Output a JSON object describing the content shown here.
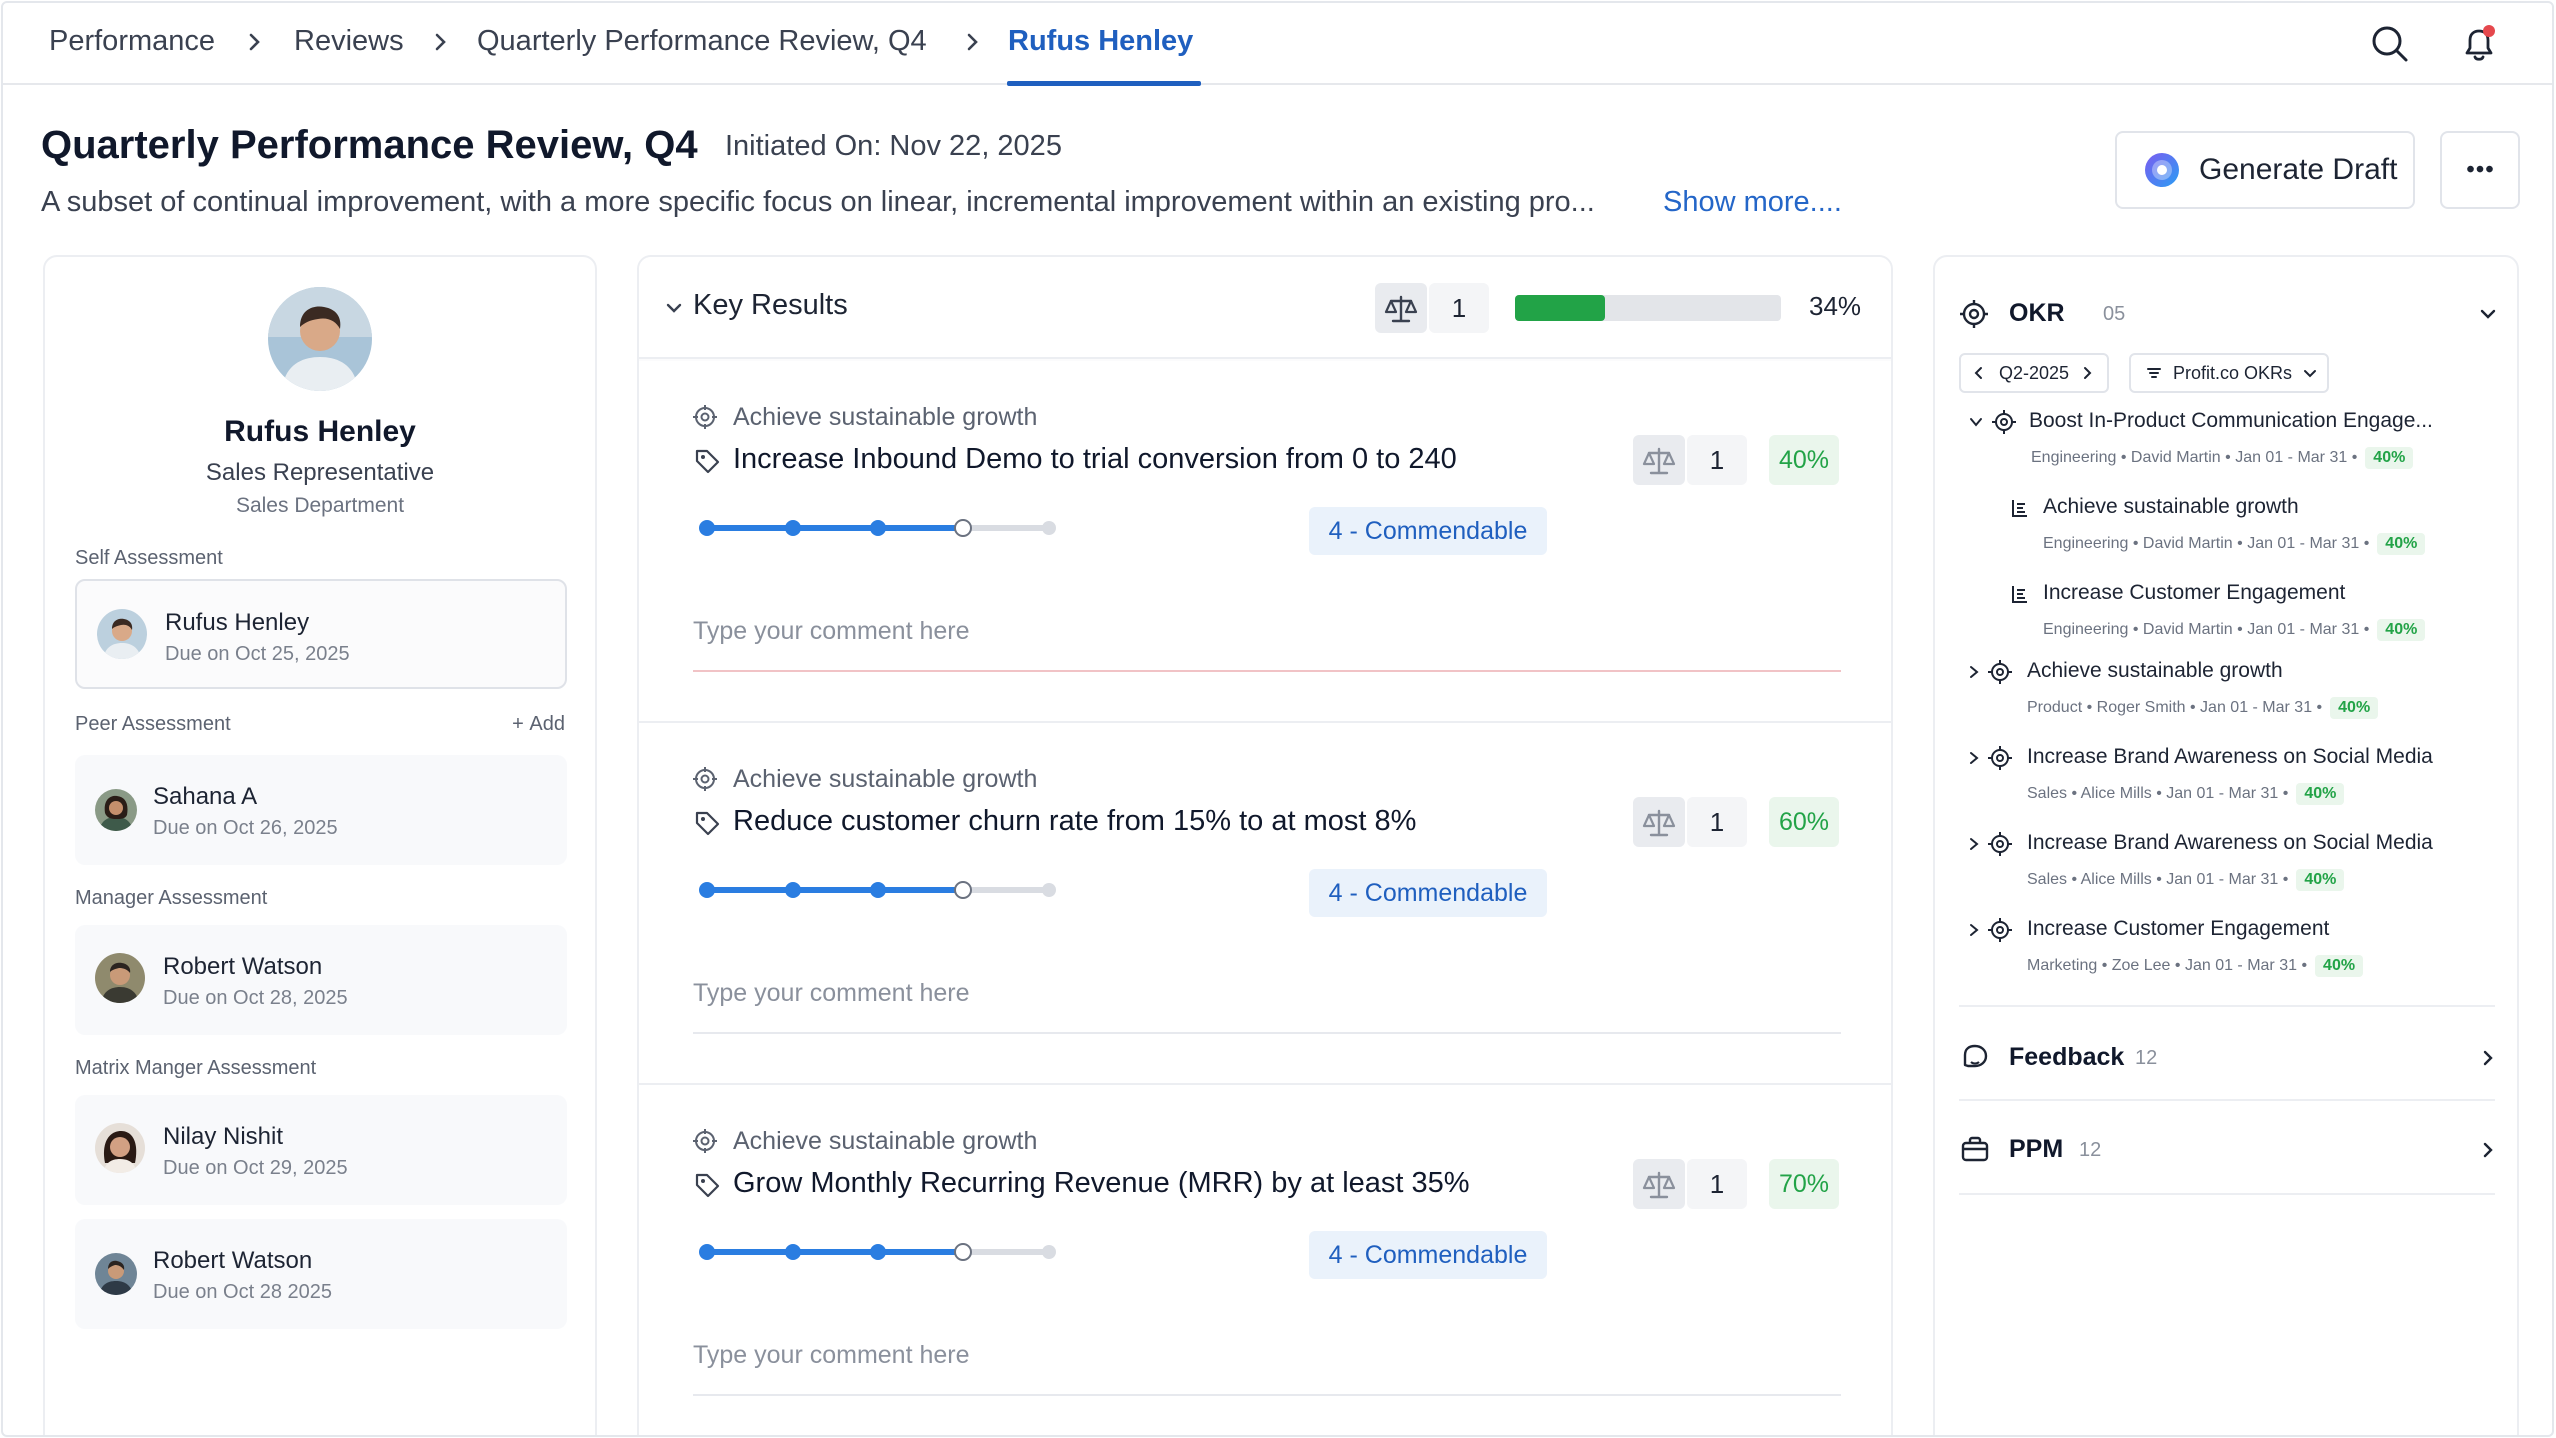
{
  "breadcrumb": {
    "items": [
      "Performance",
      "Reviews",
      "Quarterly Performance Review, Q4",
      "Rufus Henley"
    ]
  },
  "header": {
    "title": "Quarterly Performance Review, Q4",
    "initiated": "Initiated On: Nov 22, 2025",
    "description": "A subset of continual improvement, with a more specific focus on linear, incremental improvement within an existing pro...",
    "show_more": "Show more....",
    "generate_draft": "Generate Draft"
  },
  "profile": {
    "name": "Rufus Henley",
    "role": "Sales Representative",
    "department": "Sales Department"
  },
  "assessments": {
    "self_label": "Self Assessment",
    "self": {
      "name": "Rufus Henley",
      "due": "Due on Oct 25, 2025"
    },
    "peer_label": "Peer Assessment",
    "add_label": "Add",
    "peer": [
      {
        "name": "Sahana A",
        "due": "Due on Oct 26, 2025"
      }
    ],
    "manager_label": "Manager Assessment",
    "manager": [
      {
        "name": "Robert Watson",
        "due": "Due on Oct 28, 2025"
      }
    ],
    "matrix_label": "Matrix Manger Assessment",
    "matrix": [
      {
        "name": "Nilay Nishit",
        "due": "Due on Oct 29, 2025"
      },
      {
        "name": "Robert Watson",
        "due": "Due on Oct 28 2025"
      }
    ]
  },
  "key_results": {
    "title": "Key Results",
    "weight": "1",
    "progress": 0.34,
    "progress_label": "34%",
    "items": [
      {
        "objective": "Achieve sustainable growth",
        "title": "Increase Inbound Demo to trial conversion from 0 to 240",
        "weight": "1",
        "percent": "40%",
        "rating": "4 - Commendable",
        "rating_step": 3,
        "comment_placeholder": "Type your comment here"
      },
      {
        "objective": "Achieve sustainable growth",
        "title": "Reduce customer churn rate from 15% to at most 8%",
        "weight": "1",
        "percent": "60%",
        "rating": "4 - Commendable",
        "rating_step": 3,
        "comment_placeholder": "Type your comment here"
      },
      {
        "objective": "Achieve sustainable growth",
        "title": "Grow Monthly Recurring Revenue (MRR) by at least 35%",
        "weight": "1",
        "percent": "70%",
        "rating": "4 - Commendable",
        "rating_step": 3,
        "comment_placeholder": "Type your comment here"
      }
    ]
  },
  "okr": {
    "title": "OKR",
    "count": "05",
    "period": "Q2-2025",
    "filter": "Profit.co OKRs",
    "tree": [
      {
        "title": "Boost In-Product Communication Engage...",
        "meta": "Engineering • David Martin • Jan 01 - Mar 31 •",
        "badge": "40%"
      },
      {
        "title": "Achieve sustainable growth",
        "meta": "Engineering • David Martin • Jan 01 - Mar 31 •",
        "badge": "40%"
      },
      {
        "title": "Increase Customer Engagement",
        "meta": "Engineering • David Martin • Jan 01 - Mar 31 •",
        "badge": "40%"
      },
      {
        "title": "Achieve sustainable growth",
        "meta": "Product • Roger Smith • Jan 01 - Mar 31 •",
        "badge": "40%"
      },
      {
        "title": "Increase Brand Awareness on Social Media",
        "meta": "Sales • Alice Mills • Jan 01 - Mar 31 •",
        "badge": "40%"
      },
      {
        "title": "Increase Brand Awareness on Social Media",
        "meta": "Sales • Alice Mills • Jan 01 - Mar 31 •",
        "badge": "40%"
      },
      {
        "title": "Increase Customer Engagement",
        "meta": "Marketing • Zoe Lee • Jan 01 - Mar 31 •",
        "badge": "40%"
      }
    ]
  },
  "feedback": {
    "title": "Feedback",
    "count": "12"
  },
  "ppm": {
    "title": "PPM",
    "count": "12"
  },
  "colors": {
    "accent": "#1f5fbf",
    "success": "#22a347",
    "slider": "#2a7de1"
  }
}
